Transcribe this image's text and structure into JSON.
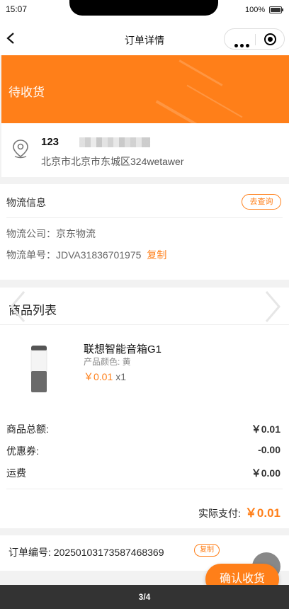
{
  "statusbar": {
    "time": "15:07",
    "battery": "100%"
  },
  "nav": {
    "title": "订单详情"
  },
  "banner": {
    "status": "待收货"
  },
  "address": {
    "name": "123",
    "address": "北京市北京市东城区324wetawer"
  },
  "logistics": {
    "title": "物流信息",
    "query_button": "去查询",
    "company_label": "物流公司：",
    "company": "京东物流",
    "tracking_label": "物流单号：",
    "tracking_no": "JDVA31836701975",
    "copy": "复制"
  },
  "goods": {
    "title": "商品列表",
    "product": {
      "name": "联想智能音箱G1",
      "spec": "产品颜色: 黄",
      "price": "￥0.01",
      "qty": "x1"
    },
    "summary": [
      {
        "label": "商品总额:",
        "value": "￥0.01"
      },
      {
        "label": "优惠券:",
        "value": "-0.00"
      },
      {
        "label": "运费",
        "value": "￥0.00"
      }
    ],
    "paid_label": "实际支付:",
    "paid_amount": "￥0.01"
  },
  "order": {
    "label": "订单编号:  20250103173587468369",
    "copy": "复制"
  },
  "actions": {
    "confirm": "确认收货"
  },
  "pager": {
    "text": "3/4"
  },
  "colors": {
    "accent": "#ff7f19"
  }
}
